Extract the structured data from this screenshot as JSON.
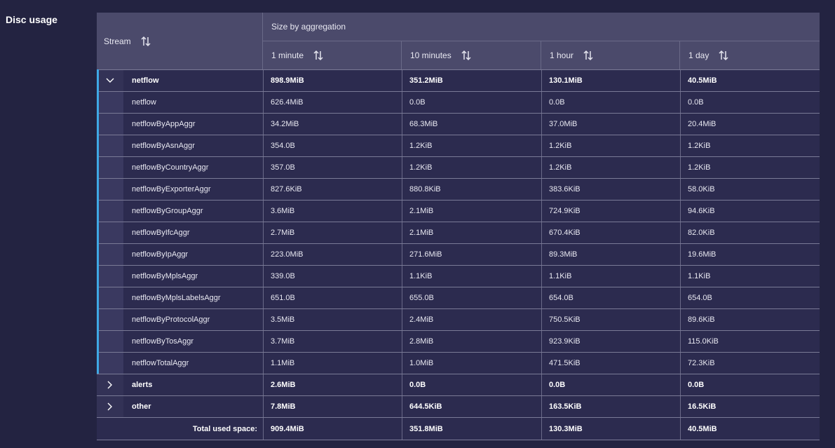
{
  "section_title": "Disc usage",
  "header": {
    "stream": "Stream",
    "size_by_aggregation": "Size by aggregation",
    "columns": [
      "1 minute",
      "10 minutes",
      "1 hour",
      "1 day"
    ]
  },
  "groups": [
    {
      "name": "netflow",
      "expanded": true,
      "values": [
        "898.9MiB",
        "351.2MiB",
        "130.1MiB",
        "40.5MiB"
      ],
      "children": [
        {
          "name": "netflow",
          "values": [
            "626.4MiB",
            "0.0B",
            "0.0B",
            "0.0B"
          ]
        },
        {
          "name": "netflowByAppAggr",
          "values": [
            "34.2MiB",
            "68.3MiB",
            "37.0MiB",
            "20.4MiB"
          ]
        },
        {
          "name": "netflowByAsnAggr",
          "values": [
            "354.0B",
            "1.2KiB",
            "1.2KiB",
            "1.2KiB"
          ]
        },
        {
          "name": "netflowByCountryAggr",
          "values": [
            "357.0B",
            "1.2KiB",
            "1.2KiB",
            "1.2KiB"
          ]
        },
        {
          "name": "netflowByExporterAggr",
          "values": [
            "827.6KiB",
            "880.8KiB",
            "383.6KiB",
            "58.0KiB"
          ]
        },
        {
          "name": "netflowByGroupAggr",
          "values": [
            "3.6MiB",
            "2.1MiB",
            "724.9KiB",
            "94.6KiB"
          ]
        },
        {
          "name": "netflowByIfcAggr",
          "values": [
            "2.7MiB",
            "2.1MiB",
            "670.4KiB",
            "82.0KiB"
          ]
        },
        {
          "name": "netflowByIpAggr",
          "values": [
            "223.0MiB",
            "271.6MiB",
            "89.3MiB",
            "19.6MiB"
          ]
        },
        {
          "name": "netflowByMplsAggr",
          "values": [
            "339.0B",
            "1.1KiB",
            "1.1KiB",
            "1.1KiB"
          ]
        },
        {
          "name": "netflowByMplsLabelsAggr",
          "values": [
            "651.0B",
            "655.0B",
            "654.0B",
            "654.0B"
          ]
        },
        {
          "name": "netflowByProtocolAggr",
          "values": [
            "3.5MiB",
            "2.4MiB",
            "750.5KiB",
            "89.6KiB"
          ]
        },
        {
          "name": "netflowByTosAggr",
          "values": [
            "3.7MiB",
            "2.8MiB",
            "923.9KiB",
            "115.0KiB"
          ]
        },
        {
          "name": "netflowTotalAggr",
          "values": [
            "1.1MiB",
            "1.0MiB",
            "471.5KiB",
            "72.3KiB"
          ]
        }
      ]
    },
    {
      "name": "alerts",
      "expanded": false,
      "values": [
        "2.6MiB",
        "0.0B",
        "0.0B",
        "0.0B"
      ],
      "children": []
    },
    {
      "name": "other",
      "expanded": false,
      "values": [
        "7.8MiB",
        "644.5KiB",
        "163.5KiB",
        "16.5KiB"
      ],
      "children": []
    }
  ],
  "footer": {
    "label": "Total used space:",
    "values": [
      "909.4MiB",
      "351.8MiB",
      "130.3MiB",
      "40.5MiB"
    ]
  },
  "colors": {
    "page_bg": "#232341",
    "header_bg": "#4b4a6b",
    "row_bg": "#2c2b4f",
    "accent": "#3fa9e6"
  }
}
